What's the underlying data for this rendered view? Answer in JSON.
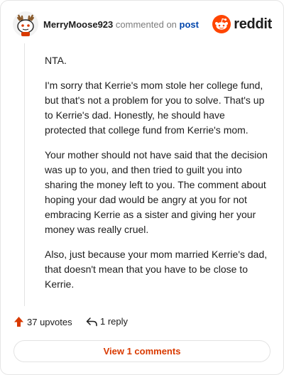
{
  "header": {
    "username": "MerryMoose923",
    "action_text": "commented on",
    "post_link": "post",
    "brand": "reddit"
  },
  "comment": {
    "paragraphs": [
      "NTA.",
      "I'm sorry that Kerrie's mom stole her college fund, but that's not a problem for you to solve. That's up to Kerrie's dad. Honestly, he should have protected that college fund from Kerrie's mom.",
      "Your mother should not have said that the decision was up to you, and then tried to guilt you into sharing the money left to you. The comment about hoping your dad would be angry at you for not embracing Kerrie as a sister and giving her your money was really cruel.",
      "Also, just because your mom married Kerrie's dad, that doesn't mean that you have to be close to Kerrie."
    ]
  },
  "footer": {
    "upvotes_label": "37 upvotes",
    "replies_label": "1 reply"
  },
  "view_comments_label": "View 1 comments",
  "colors": {
    "brand_orange": "#ff4500",
    "upvote_orange": "#d93a00",
    "link_blue": "#0045ac"
  },
  "icons": {
    "avatar": "snoo-avatar-icon",
    "upvote": "upvote-arrow-icon",
    "reply": "reply-arrow-icon",
    "brand": "reddit-logo-icon"
  }
}
